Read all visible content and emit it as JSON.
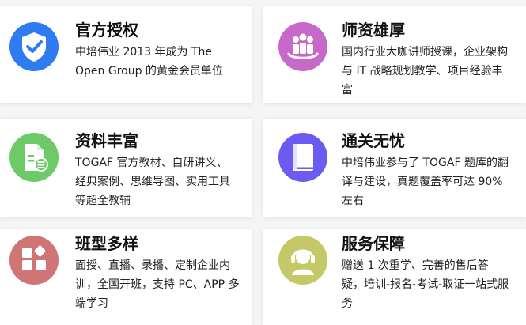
{
  "cards": [
    {
      "title": "官方授权",
      "desc": "中培伟业 2013 年成为 The Open Group 的黄金会员单位",
      "icon": "shield-check-icon",
      "color": "#2f7bf0"
    },
    {
      "title": "师资雄厚",
      "desc": "国内行业大咖讲师授课，企业架构与 IT 战略规划教学、项目经验丰富",
      "icon": "group-people-icon",
      "color": "#c769c9"
    },
    {
      "title": "资料丰富",
      "desc": "TOGAF 官方教材、自研讲义、经典案例、思维导图、实用工具等超全教辅",
      "icon": "document-stack-icon",
      "color": "#6ccb66"
    },
    {
      "title": "通关无忧",
      "desc": "中培伟业参与了 TOGAF 题库的翻译与建设，真题覆盖率可达 90%左右",
      "icon": "book-icon",
      "color": "#6b5bf0"
    },
    {
      "title": "班型多样",
      "desc": "面授、直播、录播、定制企业内训，全国开班，支持 PC、APP 多端学习",
      "icon": "grid-blocks-icon",
      "color": "#d07576"
    },
    {
      "title": "服务保障",
      "desc": "赠送 1 次重学、完善的售后答疑，培训-报名-考试-取证一站式服务",
      "icon": "headset-support-icon",
      "color": "#c5c867"
    }
  ]
}
